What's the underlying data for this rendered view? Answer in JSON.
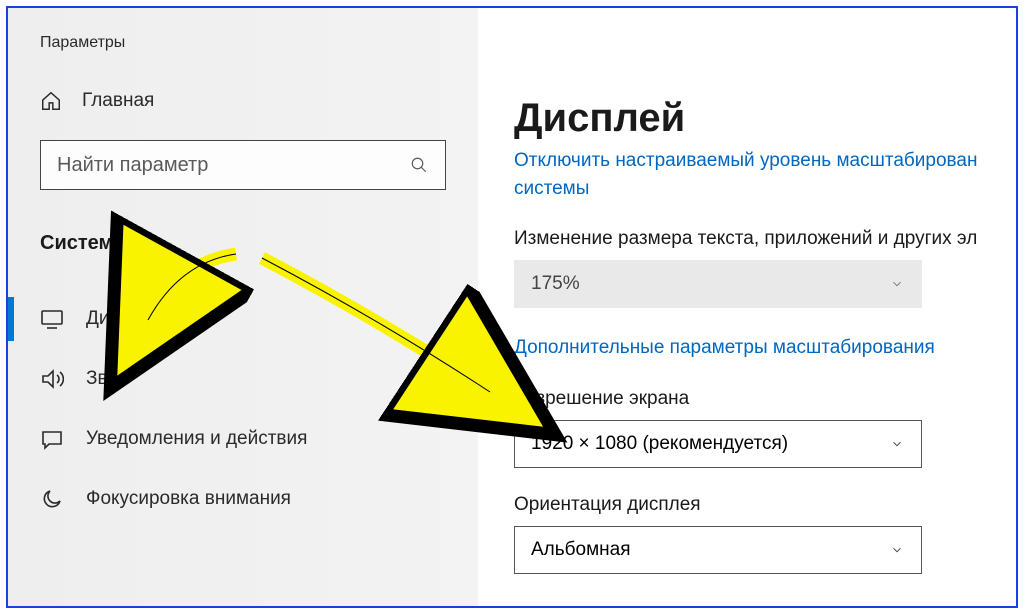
{
  "app_title": "Параметры",
  "home": {
    "label": "Главная"
  },
  "search": {
    "placeholder": "Найти параметр"
  },
  "section": {
    "label": "Система"
  },
  "nav": {
    "display": "Дисплей",
    "sound": "Звук",
    "notifications": "Уведомления и действия",
    "focus": "Фокусировка внимания"
  },
  "page": {
    "title": "Дисплей",
    "link_scale_system": "Отключить настраиваемый уровень масштабирован системы",
    "scale_label": "Изменение размера текста, приложений и других эл",
    "scale_value": "175%",
    "link_adv_scale": "Дополнительные параметры масштабирования",
    "resolution_label": "Разрешение экрана",
    "resolution_value": "1920 × 1080 (рекомендуется)",
    "orientation_label": "Ориентация дисплея",
    "orientation_value": "Альбомная"
  }
}
